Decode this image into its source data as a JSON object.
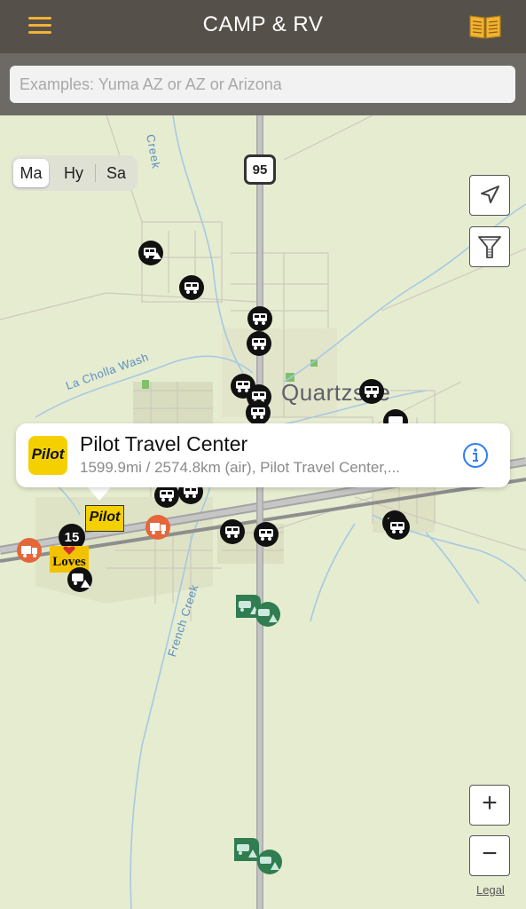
{
  "header": {
    "title": "CAMP & RV",
    "menu_icon": "hamburger-menu-icon",
    "book_icon": "book-icon",
    "accent_color": "#f2b233"
  },
  "search": {
    "placeholder": "Examples: Yuma AZ or AZ or Arizona"
  },
  "map": {
    "map_type_options": [
      "Ma",
      "Hy",
      "Sa"
    ],
    "selected_map_type": "Ma",
    "place_label": "Quartzsite",
    "road_shields": [
      "95",
      "15"
    ],
    "water_labels": [
      "Creek",
      "La Cholla Wash",
      "French Creek"
    ],
    "brand_markers": [
      "Pilot",
      "Loves"
    ],
    "controls": {
      "locate_icon": "location-arrow-icon",
      "filter_icon": "filter-funnel-icon",
      "zoom_in": "+",
      "zoom_out": "−"
    },
    "legal": "Legal"
  },
  "callout": {
    "logo_text": "Pilot",
    "name": "Pilot Travel Center",
    "subtitle": "1599.9mi / 2574.8km (air), Pilot Travel Center,...",
    "info_icon": "info-circle-icon"
  }
}
